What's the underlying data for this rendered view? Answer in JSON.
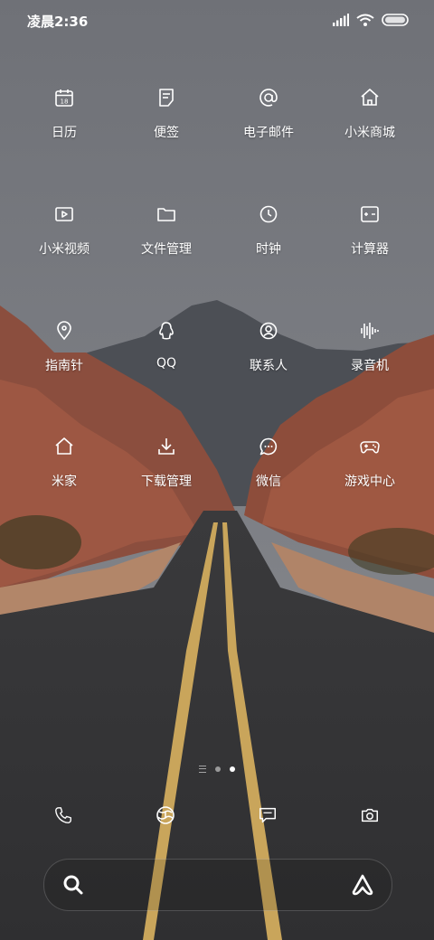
{
  "status_bar": {
    "time": "凌晨2:36"
  },
  "apps": [
    {
      "label": "日历",
      "icon": "calendar-icon",
      "badge": "18"
    },
    {
      "label": "便签",
      "icon": "notes-icon"
    },
    {
      "label": "电子邮件",
      "icon": "email-icon"
    },
    {
      "label": "小米商城",
      "icon": "shop-icon"
    },
    {
      "label": "小米视频",
      "icon": "video-icon"
    },
    {
      "label": "文件管理",
      "icon": "folder-icon"
    },
    {
      "label": "时钟",
      "icon": "clock-icon"
    },
    {
      "label": "计算器",
      "icon": "calculator-icon"
    },
    {
      "label": "指南针",
      "icon": "compass-icon"
    },
    {
      "label": "QQ",
      "icon": "qq-icon"
    },
    {
      "label": "联系人",
      "icon": "contacts-icon"
    },
    {
      "label": "录音机",
      "icon": "recorder-icon"
    },
    {
      "label": "米家",
      "icon": "home-icon"
    },
    {
      "label": "下载管理",
      "icon": "download-icon"
    },
    {
      "label": "微信",
      "icon": "wechat-icon"
    },
    {
      "label": "游戏中心",
      "icon": "gamepad-icon"
    }
  ],
  "pager": {
    "pages": 2,
    "active": 2
  },
  "dock": [
    {
      "icon": "phone-icon"
    },
    {
      "icon": "browser-icon"
    },
    {
      "icon": "messages-icon"
    },
    {
      "icon": "camera-icon"
    }
  ],
  "search_bar": {
    "left_icon": "search-icon",
    "right_icon": "assistant-icon"
  }
}
